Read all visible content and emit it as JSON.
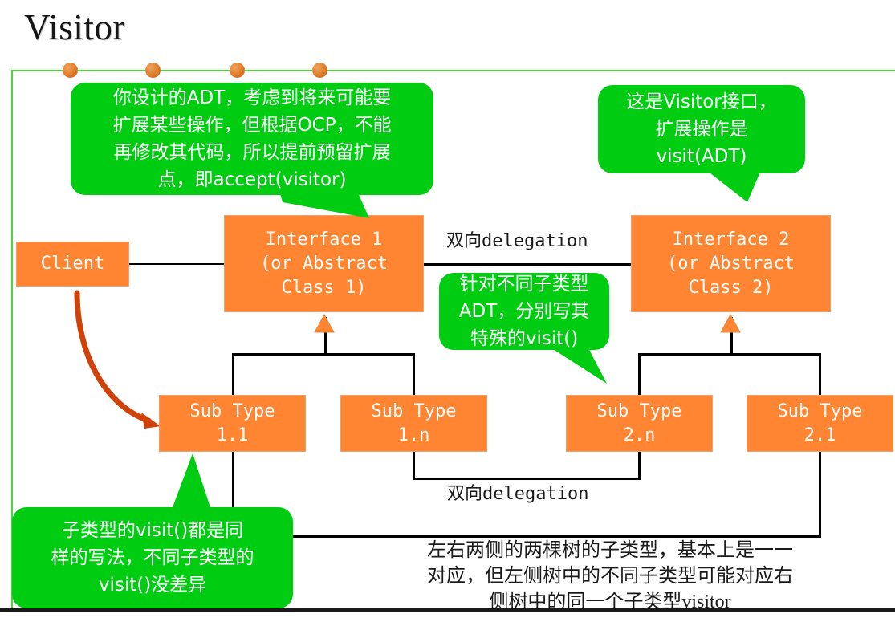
{
  "slide": {
    "title": "Visitor",
    "accent_green": "#00cc11",
    "frame_green": "#4fd43a",
    "box_orange": "#ff8533",
    "arrow_orange": "#d1410a",
    "line_black": "#000000",
    "bullet_count": 4
  },
  "callouts": {
    "top_left": "你设计的ADT，考虑到将来可能要\n扩展某些操作，但根据OCP，不能\n再修改其代码，所以提前预留扩展\n点，即accept(visitor)",
    "top_right": "这是Visitor接口，\n扩展操作是\nvisit(ADT)",
    "middle": "针对不同子类型\nADT，分别写其\n特殊的visit()",
    "bottom_left": "子类型的visit()都是同\n样的写法，不同子类型的\nvisit()没差异"
  },
  "boxes": {
    "client": "Client",
    "interface1": "Interface 1\n(or Abstract\nClass 1)",
    "interface2": "Interface 2\n(or Abstract\nClass 2)",
    "subtype_1_1": "Sub Type\n1.1",
    "subtype_1_n": "Sub Type\n1.n",
    "subtype_2_n": "Sub Type\n2.n",
    "subtype_2_1": "Sub Type\n2.1"
  },
  "labels": {
    "delegation_top": "双向delegation",
    "delegation_bottom": "双向delegation",
    "footer_note": "左右两侧的两棵树的子类型，基本上是一一\n对应，但左侧树中的不同子类型可能对应右\n侧树中的同一个子类型visitor"
  }
}
